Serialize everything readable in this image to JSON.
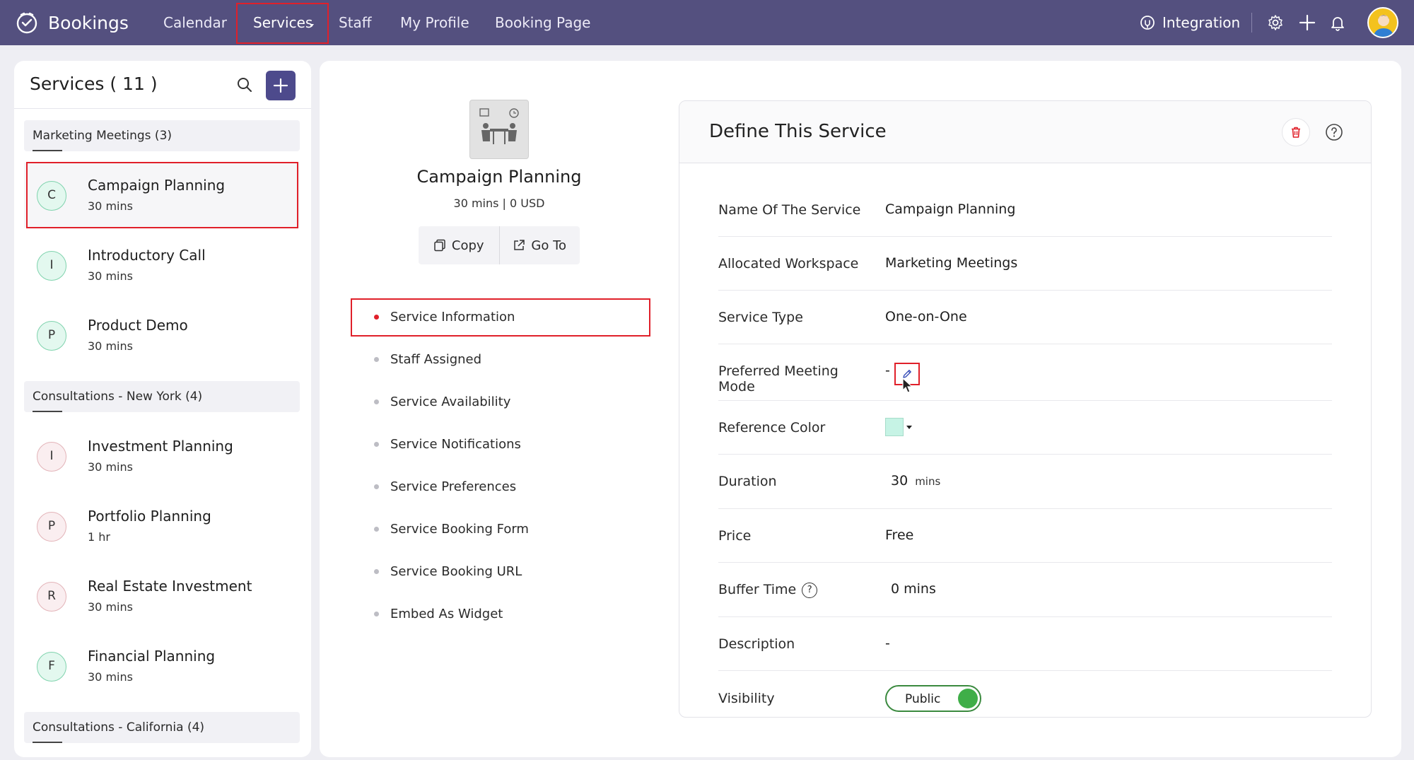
{
  "app": {
    "name": "Bookings"
  },
  "nav": {
    "items": [
      "Calendar",
      "Services",
      "Staff",
      "My Profile",
      "Booking Page"
    ],
    "active": "Services",
    "integration": "Integration"
  },
  "services_panel": {
    "title": "Services ( 11 )",
    "groups": [
      {
        "label": "Marketing Meetings (3)"
      },
      {
        "label": "Consultations - New York (4)"
      },
      {
        "label": "Consultations - California (4)"
      }
    ],
    "items": [
      {
        "initial": "C",
        "name": "Campaign Planning",
        "duration": "30 mins"
      },
      {
        "initial": "I",
        "name": "Introductory Call",
        "duration": "30 mins"
      },
      {
        "initial": "P",
        "name": "Product Demo",
        "duration": "30 mins"
      },
      {
        "initial": "I",
        "name": "Investment Planning",
        "duration": "30 mins"
      },
      {
        "initial": "P",
        "name": "Portfolio Planning",
        "duration": "1 hr"
      },
      {
        "initial": "R",
        "name": "Real Estate Investment",
        "duration": "30 mins"
      },
      {
        "initial": "F",
        "name": "Financial Planning",
        "duration": "30 mins"
      }
    ]
  },
  "summary": {
    "name": "Campaign Planning",
    "meta": "30 mins | 0 USD",
    "copy_label": "Copy",
    "goto_label": "Go To"
  },
  "side_menu": {
    "items": [
      "Service Information",
      "Staff Assigned",
      "Service Availability",
      "Service Notifications",
      "Service Preferences",
      "Service Booking Form",
      "Service Booking URL",
      "Embed As Widget"
    ],
    "active": "Service Information"
  },
  "define": {
    "title": "Define This Service",
    "rows": {
      "name": {
        "label": "Name Of The Service",
        "value": "Campaign Planning"
      },
      "workspace": {
        "label": "Allocated Workspace",
        "value": "Marketing Meetings"
      },
      "type": {
        "label": "Service Type",
        "value": "One-on-One"
      },
      "mode": {
        "label": "Preferred Meeting Mode",
        "value": "-"
      },
      "color": {
        "label": "Reference Color",
        "value": "#c6f3e5"
      },
      "duration": {
        "label": "Duration",
        "value": "30",
        "unit": "mins"
      },
      "price": {
        "label": "Price",
        "value": "Free"
      },
      "buffer": {
        "label": "Buffer Time",
        "value": "0 mins"
      },
      "description": {
        "label": "Description",
        "value": "-"
      },
      "visibility": {
        "label": "Visibility",
        "value": "Public"
      }
    }
  },
  "colors": {
    "nav_bg": "#54507f",
    "accent": "#4d4a8c",
    "highlight": "#e0202a",
    "toggle_on": "#3fae48"
  }
}
